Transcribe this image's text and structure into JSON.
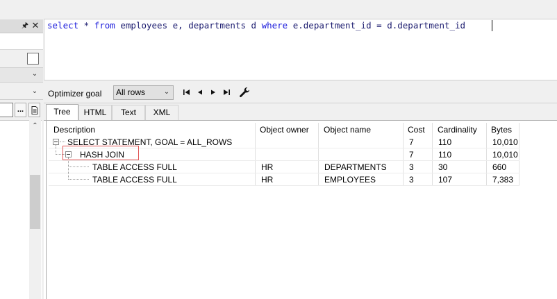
{
  "editor": {
    "sql_tokens": [
      {
        "text": "select",
        "kw": true
      },
      {
        "text": " * ",
        "kw": false
      },
      {
        "text": "from",
        "kw": true
      },
      {
        "text": " employees e, departments d ",
        "kw": false
      },
      {
        "text": "where",
        "kw": true
      },
      {
        "text": " e.department_id = d.department_id",
        "kw": false
      }
    ]
  },
  "left_panel": {
    "pin_icon": "pin-icon",
    "close_icon": "close-icon",
    "ellipsis_label": "..."
  },
  "toolbar": {
    "optimizer_label": "Optimizer goal",
    "goal_value": "All rows",
    "nav_icons": [
      "first-icon",
      "previous-icon",
      "next-icon",
      "last-icon"
    ],
    "wrench_icon": "wrench-icon"
  },
  "tabs": [
    {
      "label": "Tree",
      "active": true
    },
    {
      "label": "HTML",
      "active": false
    },
    {
      "label": "Text",
      "active": false
    },
    {
      "label": "XML",
      "active": false
    }
  ],
  "plan": {
    "columns": [
      "Description",
      "Object owner",
      "Object name",
      "Cost",
      "Cardinality",
      "Bytes"
    ],
    "rows": [
      {
        "description": "SELECT STATEMENT, GOAL = ALL_ROWS",
        "owner": "",
        "name": "",
        "cost": "7",
        "cardinality": "110",
        "bytes": "10,010",
        "level": 0
      },
      {
        "description": "HASH JOIN",
        "owner": "",
        "name": "",
        "cost": "7",
        "cardinality": "110",
        "bytes": "10,010",
        "level": 1
      },
      {
        "description": "TABLE ACCESS FULL",
        "owner": "HR",
        "name": "DEPARTMENTS",
        "cost": "3",
        "cardinality": "30",
        "bytes": "660",
        "level": 2
      },
      {
        "description": "TABLE ACCESS FULL",
        "owner": "HR",
        "name": "EMPLOYEES",
        "cost": "3",
        "cardinality": "107",
        "bytes": "7,383",
        "level": 2
      }
    ],
    "highlight_color": "#e05252"
  }
}
